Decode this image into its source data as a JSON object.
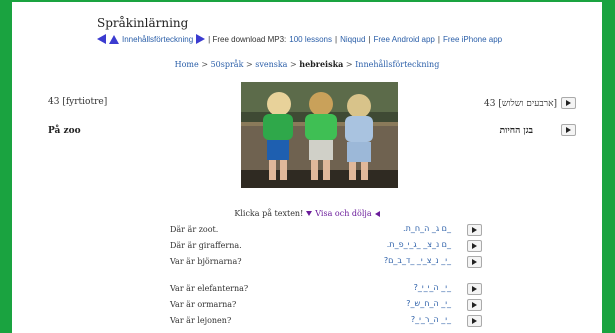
{
  "header": {
    "title": "Språkinlärning"
  },
  "navbar": {
    "toc_label": "Innehållsförteckning",
    "separator_text": "| Free download MP3:",
    "lessons_link": "100 lessons",
    "niqqud_link": "Niqqud",
    "android_link": "Free Android app",
    "iphone_link": "Free iPhone app",
    "pipe": "|"
  },
  "breadcrumb": {
    "home": "Home",
    "sep": ">",
    "languages": "50språk",
    "swedish": "svenska",
    "current": "hebreiska",
    "toc": "Innehållsförteckning"
  },
  "lesson": {
    "number": "43 [fyrtiotre]",
    "title": "På zoo",
    "number_he": "43 [ארבעים ושלוש]",
    "title_he": "בגן החיות"
  },
  "instructions": {
    "click_text": "Klicka på texten!",
    "toggle": "Visa och dölja"
  },
  "phrases": [
    {
      "sv": "Där är zoot.",
      "he": "_ם ג_ ה_ח_ת."
    },
    {
      "sv": "Där är girafferna.",
      "he": "_ם נ_צ_ _ג_י_פ_ת."
    },
    {
      "sv": "Var är björnarna?",
      "he": "_י_ נ_צ_י_ _ד_ב_ם?"
    },
    {
      "sv": "Var är elefanterna?",
      "he": "_י_ ה_י_י_?"
    },
    {
      "sv": "Var är ormarna?",
      "he": "_י_ ה_ח_ש_?"
    },
    {
      "sv": "Var är lejonen?",
      "he": "_י_ ה_ר_י_?"
    }
  ],
  "colors": {
    "frame": "#1aa340",
    "link": "#2a5ea8",
    "accent": "#3b3bd0",
    "toggle": "#6a1b9a"
  }
}
